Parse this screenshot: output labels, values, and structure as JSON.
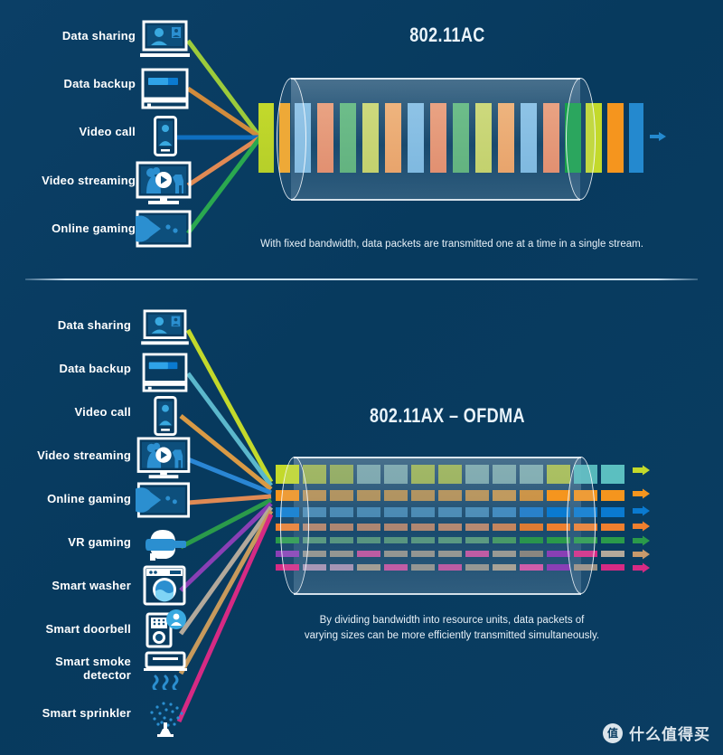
{
  "background_color": "#0a3d62",
  "divider": {
    "color": "#cfe3f3"
  },
  "sections": [
    {
      "id": "ac",
      "title": "802.11AC",
      "caption": "With fixed bandwidth, data packets are transmitted one at a time in a single stream.",
      "devices": [
        {
          "label": "Data sharing",
          "icon": "laptop-video-share-icon",
          "line_color": "#9ccb3b"
        },
        {
          "label": "Data backup",
          "icon": "monitor-progress-icon",
          "line_color": "#d18b3c"
        },
        {
          "label": "Video call",
          "icon": "smartphone-person-icon",
          "line_color": "#0f6fc0"
        },
        {
          "label": "Video streaming",
          "icon": "tv-play-safari-icon",
          "line_color": "#e08a54"
        },
        {
          "label": "Online gaming",
          "icon": "monitor-pacman-icon",
          "line_color": "#2aa84f"
        }
      ],
      "packets_in": [
        "#c3d92b",
        "#f5a31e"
      ],
      "packets_stream": [
        "#8ec3e6",
        "#e9a383",
        "#6dbd8a",
        "#cdd97d",
        "#eeb47e",
        "#8ec3e6",
        "#e9a383",
        "#6dbd8a",
        "#cdd97d",
        "#eeb47e",
        "#8ec3e6",
        "#e9a383"
      ],
      "packets_out": [
        "#17a04a",
        "#c3d92b",
        "#f5951e",
        "#2489cf"
      ],
      "arrow_color": "#2489cf"
    },
    {
      "id": "ax",
      "title": "802.11AX – OFDMA",
      "caption": "By dividing bandwidth into resource units, data packets of\nvarying sizes can be more efficiently transmitted simultaneously.",
      "devices": [
        {
          "label": "Data sharing",
          "icon": "laptop-video-share-icon",
          "line_color": "#c3d92b"
        },
        {
          "label": "Data backup",
          "icon": "monitor-progress-icon",
          "line_color": "#5bb8cc"
        },
        {
          "label": "Video call",
          "icon": "smartphone-person-icon",
          "line_color": "#d99a45"
        },
        {
          "label": "Video streaming",
          "icon": "tv-play-safari-icon",
          "line_color": "#2a86d4"
        },
        {
          "label": "Online gaming",
          "icon": "monitor-pacman-icon",
          "line_color": "#e08a54"
        },
        {
          "label": "VR gaming",
          "icon": "vr-headset-icon",
          "line_color": "#2a9a4a"
        },
        {
          "label": "Smart washer",
          "icon": "washing-machine-icon",
          "line_color": "#8a3fb5"
        },
        {
          "label": "Smart doorbell",
          "icon": "doorbell-person-icon",
          "line_color": "#b3a99b"
        },
        {
          "label": "Smart smoke\ndetector",
          "icon": "smoke-detector-icon",
          "line_color": "#c79a5c"
        },
        {
          "label": "Smart sprinkler",
          "icon": "sprinkler-icon",
          "line_color": "#d62a84"
        }
      ],
      "rows": [
        {
          "name": "row-yellow",
          "color": "#c3d92b",
          "arrow_color": "#c3d92b"
        },
        {
          "name": "row-orange",
          "color": "#f5951e",
          "arrow_color": "#f5951e"
        },
        {
          "name": "row-blue",
          "color": "#0a7ad0",
          "arrow_color": "#0a7ad0"
        },
        {
          "name": "row-peach",
          "color": "#ef7f2e",
          "arrow_color": "#ef7f2e"
        },
        {
          "name": "row-green",
          "color": "#2a9a4a",
          "arrow_color": "#2a9a4a"
        },
        {
          "name": "row-mixed1",
          "color": "#8a3fb5",
          "arrow_color": "#c79a6c"
        },
        {
          "name": "row-mixed2",
          "color": "#d62a84",
          "arrow_color": "#d62a84"
        }
      ],
      "mixed_palette": [
        "#8a3fb5",
        "#d62a84",
        "#b3a99b",
        "#c79a5c",
        "#e75fb0",
        "#9b8f82"
      ]
    }
  ],
  "watermark": {
    "badge": "值",
    "text": "什么值得买"
  }
}
